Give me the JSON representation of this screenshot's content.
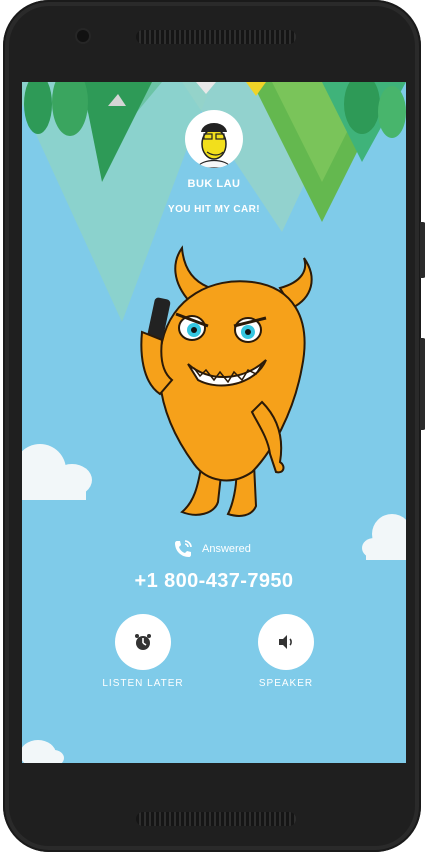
{
  "caller": {
    "name": "BUK LAU",
    "message": "YOU HIT MY CAR!"
  },
  "call": {
    "status": "Answered",
    "number": "+1 800-437-7950"
  },
  "actions": [
    {
      "label": "LISTEN LATER",
      "icon": "alarm-icon"
    },
    {
      "label": "SPEAKER",
      "icon": "speaker-icon"
    }
  ],
  "colors": {
    "sky": "#7fcbe9",
    "monster": "#f6a11a",
    "tree_dark": "#2e9a57",
    "tree_light": "#5cbfa0"
  }
}
